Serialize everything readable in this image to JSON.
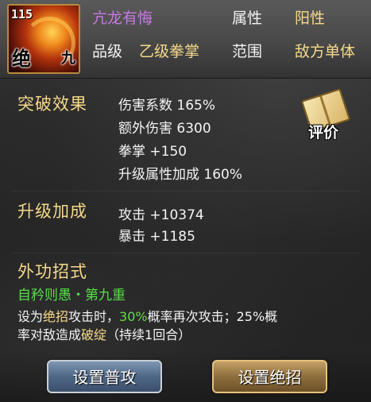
{
  "header": {
    "level": "115",
    "avatar_tag_left": "绝",
    "avatar_tag_right": "九",
    "skill_name": "亢龙有悔",
    "attribute_label": "属性",
    "attribute_value": "阳性",
    "grade_label": "品级",
    "grade_value": "乙级拳掌",
    "range_label": "范围",
    "range_value": "敌方单体"
  },
  "breakthrough": {
    "title": "突破效果",
    "lines": [
      "伤害系数 165%",
      "额外伤害 6300",
      "拳掌 +150",
      "升级属性加成 160%"
    ]
  },
  "review_button": {
    "label": "评价"
  },
  "upgrade_bonus": {
    "title": "升级加成",
    "lines": [
      "攻击 +10374",
      "暴击 +1185"
    ]
  },
  "external_moves": {
    "title": "外功招式",
    "move_name": "自矜则愚・第九重",
    "desc_l1_a": "设为",
    "desc_l1_b": "绝招",
    "desc_l1_c": "攻击时，",
    "desc_l1_d": "30%",
    "desc_l1_e": "概率再次攻击；25%概",
    "desc_l2_a": "率对敌造成",
    "desc_l2_b": "破绽",
    "desc_l2_c": "（持续1回合）"
  },
  "buttons": {
    "set_normal": "设置普攻",
    "set_ultimate": "设置绝招"
  },
  "colors": {
    "accent_gold": "#f5d98a",
    "skill_name_purple": "#c77ae0",
    "move_green": "#55e046",
    "button_blue": "#4f6786",
    "button_gold": "#8e6e3c"
  }
}
